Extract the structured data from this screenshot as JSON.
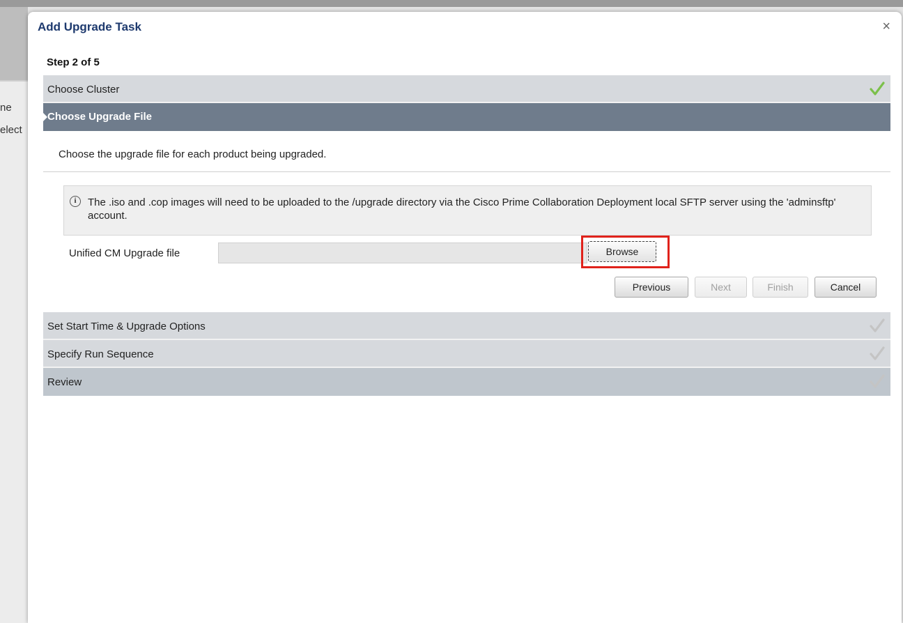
{
  "background": {
    "text_line1": "ne",
    "text_line2": "elect"
  },
  "modal": {
    "title": "Add Upgrade Task",
    "close_symbol": "×",
    "step_label": "Step 2 of 5"
  },
  "steps": [
    {
      "label": "Choose Cluster",
      "status": "complete",
      "icon": "check-icon",
      "color": "#7cc04b"
    },
    {
      "label": "Choose Upgrade File",
      "status": "active"
    },
    {
      "label": "Set Start Time & Upgrade Options",
      "status": "pending",
      "icon": "check-icon",
      "color": "#c4c4c4"
    },
    {
      "label": "Specify Run Sequence",
      "status": "pending",
      "icon": "check-icon",
      "color": "#c4c4c4"
    },
    {
      "label": "Review",
      "status": "pending",
      "icon": "check-icon",
      "color": "#c4c4c4"
    }
  ],
  "panel": {
    "description": "Choose the upgrade file for each product being upgraded.",
    "info_icon": "info-icon",
    "info_text": "The .iso and .cop images will need to be uploaded to the /upgrade directory via the Cisco Prime Collaboration Deployment local SFTP server using the 'adminsftp' account.",
    "field_label": "Unified CM Upgrade file",
    "field_value": "",
    "browse_label": "Browse",
    "highlight_color": "#e0221b"
  },
  "buttons": {
    "previous": "Previous",
    "next": "Next",
    "finish": "Finish",
    "cancel": "Cancel"
  }
}
